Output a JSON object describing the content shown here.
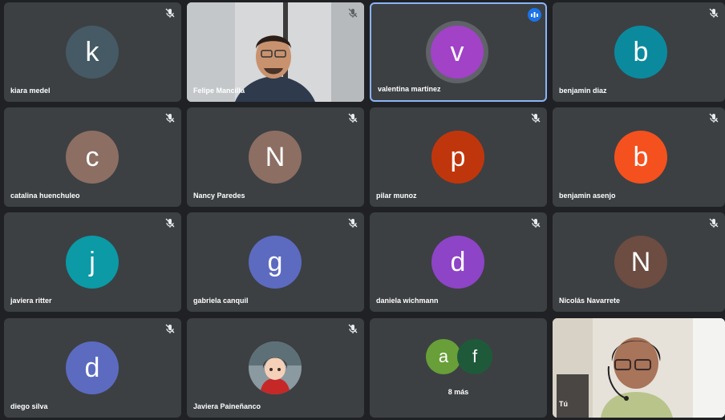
{
  "participants": [
    {
      "name": "kiara medel",
      "initial": "k",
      "color": "#455a64"
    },
    {
      "name": "Felipe Mancilla",
      "initial": "",
      "color": ""
    },
    {
      "name": "valentina martinez",
      "initial": "v",
      "color": "#a142c7"
    },
    {
      "name": "benjamin diaz",
      "initial": "b",
      "color": "#0b8a9e"
    },
    {
      "name": "catalina huenchuleo",
      "initial": "c",
      "color": "#8d6e63"
    },
    {
      "name": "Nancy Paredes",
      "initial": "N",
      "color": "#8d6e63"
    },
    {
      "name": "pilar munoz",
      "initial": "p",
      "color": "#c0360c"
    },
    {
      "name": "benjamin asenjo",
      "initial": "b",
      "color": "#f4511e"
    },
    {
      "name": "javiera ritter",
      "initial": "j",
      "color": "#0b9aa6"
    },
    {
      "name": "gabriela canquil",
      "initial": "g",
      "color": "#5c6bc0"
    },
    {
      "name": "daniela wichmann",
      "initial": "d",
      "color": "#8e44c6"
    },
    {
      "name": "Nicolás Navarrete",
      "initial": "N",
      "color": "#6d4c41"
    },
    {
      "name": "diego silva",
      "initial": "d",
      "color": "#5c6bc0"
    },
    {
      "name": "Javiera Paineñanco",
      "initial": "",
      "color": ""
    }
  ],
  "more": {
    "label": "8 más",
    "avatars": [
      {
        "initial": "a",
        "color": "#689f38"
      },
      {
        "initial": "f",
        "color": "#1e5a3a"
      }
    ]
  },
  "self": {
    "name": "Tú"
  },
  "icons": {
    "muted": "mic-off-icon",
    "speaking": "audio-level-icon"
  }
}
